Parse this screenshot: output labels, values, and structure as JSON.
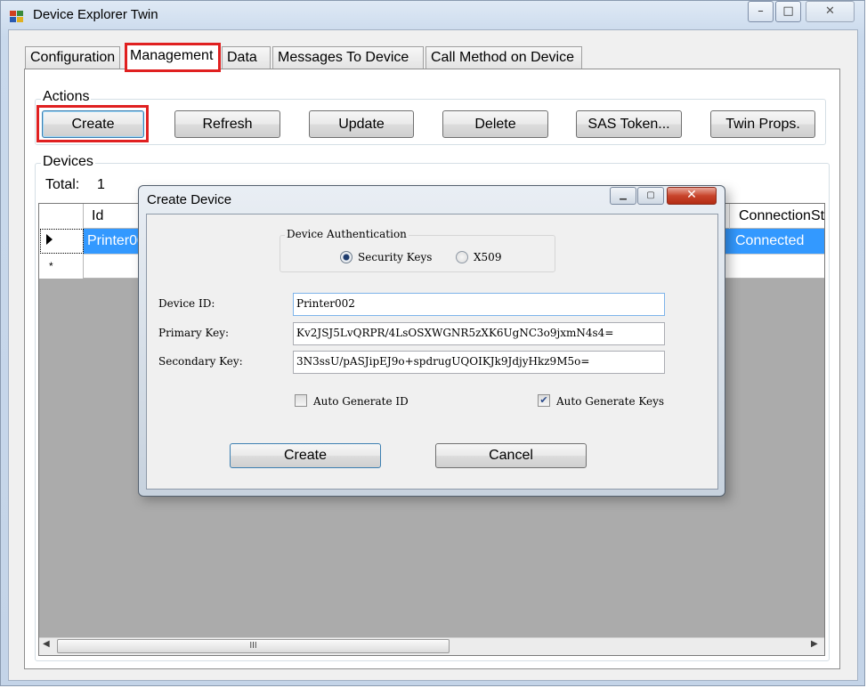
{
  "window": {
    "title": "Device Explorer Twin",
    "minimize_glyph": "–",
    "maximize_glyph": "□",
    "close_glyph": "✕"
  },
  "tabs": [
    {
      "label": "Configuration"
    },
    {
      "label": "Management",
      "selected": true
    },
    {
      "label": "Data"
    },
    {
      "label": "Messages To Device"
    },
    {
      "label": "Call Method on Device"
    }
  ],
  "actions": {
    "group_label": "Actions",
    "buttons": [
      "Create",
      "Refresh",
      "Update",
      "Delete",
      "SAS Token...",
      "Twin Props."
    ]
  },
  "devices": {
    "group_label": "Devices",
    "total_label": "Total:",
    "total_value": "1",
    "columns": [
      "Id",
      "ConnectionSt"
    ],
    "rows": [
      {
        "id": "Printer00",
        "connection": "Connected"
      }
    ],
    "new_row_marker": "*",
    "scroll_thumb_grip": "III"
  },
  "dialog": {
    "title": "Create Device",
    "close_glyph": "✕",
    "auth_group_label": "Device Authentication",
    "radio_options": [
      {
        "label": "Security Keys",
        "selected": true
      },
      {
        "label": "X509",
        "selected": false
      }
    ],
    "device_id_label": "Device ID:",
    "device_id_value": "Printer002",
    "primary_key_label": "Primary Key:",
    "primary_key_value": "Kv2JSJ5LvQRPR/4LsOSXWGNR5zXK6UgNC3o9jxmN4s4=",
    "secondary_key_label": "Secondary Key:",
    "secondary_key_value": "3N3ssU/pASJipEJ9o+spdrugUQOIKJk9JdjyHkz9M5o=",
    "auto_generate_id_label": "Auto Generate ID",
    "auto_generate_id_checked": false,
    "auto_generate_keys_label": "Auto Generate Keys",
    "auto_generate_keys_checked": true,
    "check_glyph": "✔",
    "create_label": "Create",
    "cancel_label": "Cancel"
  },
  "colors": {
    "highlight_annotation": "#e02020",
    "selection": "#3399ff",
    "grid_background": "#ababab"
  }
}
